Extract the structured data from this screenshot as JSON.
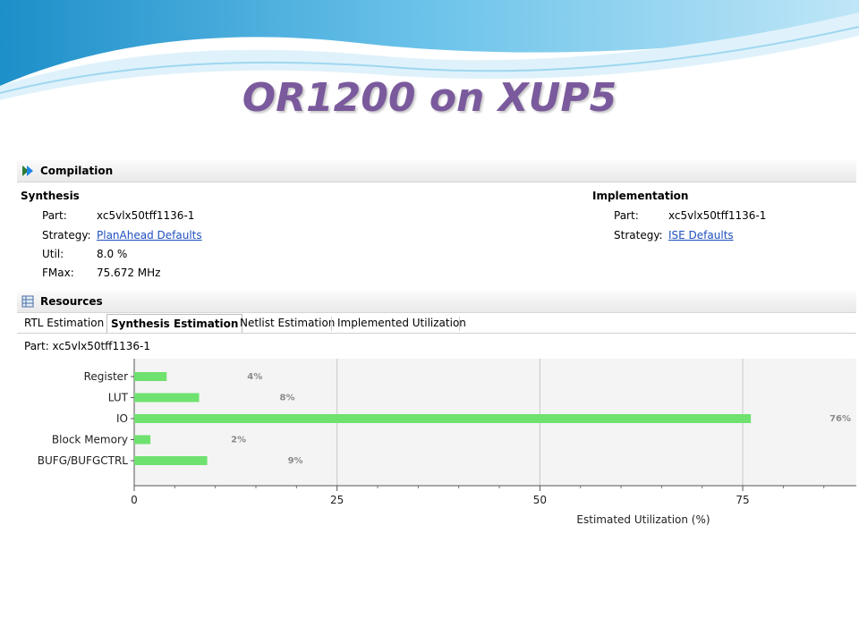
{
  "slide": {
    "title": "OR1200 on XUP5"
  },
  "compilation": {
    "header": "Compilation",
    "synthesis": {
      "heading": "Synthesis",
      "part_label": "Part:",
      "part_value": "xc5vlx50tff1136-1",
      "strategy_label": "Strategy:",
      "strategy_value": "PlanAhead Defaults",
      "util_label": "Util:",
      "util_value": "8.0 %",
      "fmax_label": "FMax:",
      "fmax_value": "75.672 MHz"
    },
    "implementation": {
      "heading": "Implementation",
      "part_label": "Part:",
      "part_value": "xc5vlx50tff1136-1",
      "strategy_label": "Strategy:",
      "strategy_value": "ISE Defaults"
    }
  },
  "resources": {
    "header": "Resources",
    "tabs": [
      {
        "label": "RTL Estimation",
        "active": false
      },
      {
        "label": "Synthesis Estimation",
        "active": true
      },
      {
        "label": "Netlist Estimation",
        "active": false
      },
      {
        "label": "Implemented Utilization",
        "active": false
      }
    ],
    "part_line": "Part:  xc5vlx50tff1136-1"
  },
  "colors": {
    "bar": "#6fe16f",
    "title": "#7a5a9c",
    "link": "#1f4fbf",
    "plot_bg": "#f4f4f4"
  },
  "icons": {
    "compilation": "play-arrows-icon",
    "resources": "table-grid-icon"
  },
  "chart_data": {
    "type": "bar",
    "orientation": "horizontal",
    "categories": [
      "Register",
      "LUT",
      "IO",
      "Block Memory",
      "BUFG/BUFGCTRL"
    ],
    "values": [
      4,
      8,
      76,
      2,
      9
    ],
    "value_labels": [
      "4%",
      "8%",
      "76%",
      "2%",
      "9%"
    ],
    "xlabel": "Estimated Utilization (%)",
    "xlim": [
      0,
      89
    ],
    "xticks": [
      0,
      25,
      50,
      75
    ],
    "grid": true
  }
}
